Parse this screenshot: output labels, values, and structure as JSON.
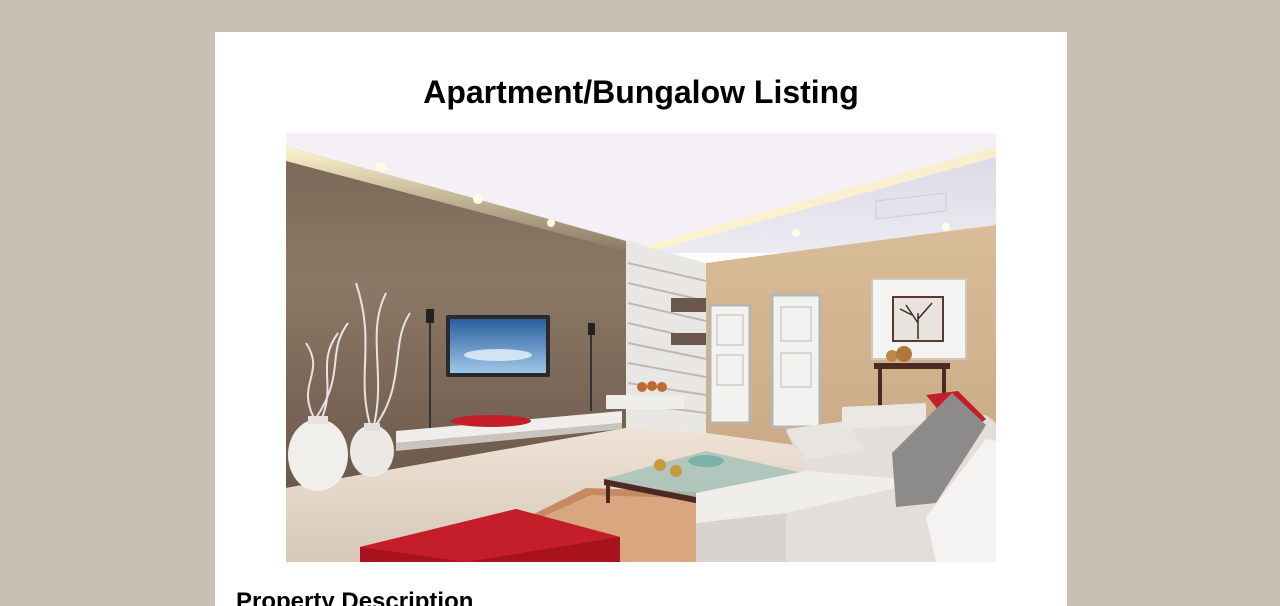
{
  "listing": {
    "title": "Apartment/Bungalow Listing",
    "photo_alt": "Living room interior",
    "description_heading": "Property Description"
  },
  "colors": {
    "page_background": "#c9c0b5",
    "card_background": "#ffffff",
    "text": "#000000"
  }
}
